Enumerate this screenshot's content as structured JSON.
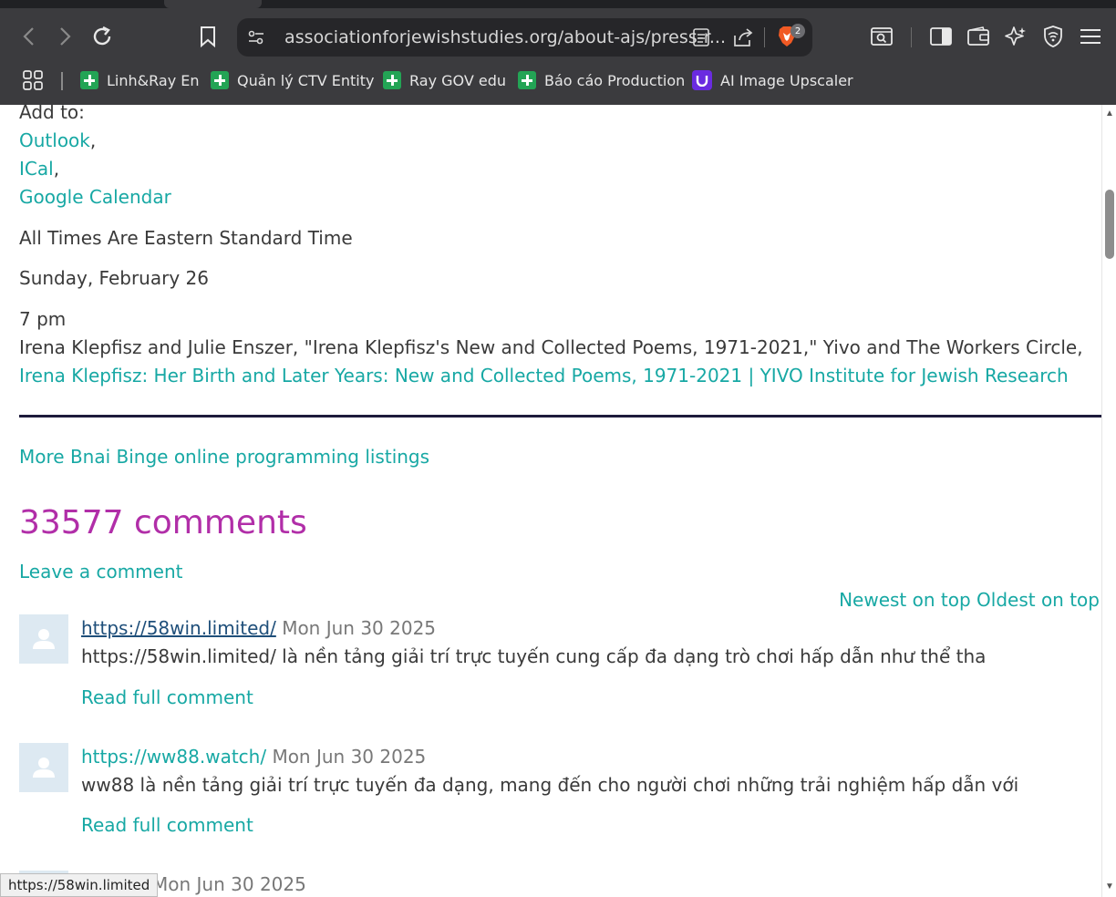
{
  "browser": {
    "url": "associationforjewishstudies.org/about-ajs/press-r...",
    "shields_count": "2",
    "bookmarks": [
      {
        "label": "Linh&Ray En",
        "icon": "sheets-icon"
      },
      {
        "label": "Quản lý CTV Entity",
        "icon": "sheets-icon"
      },
      {
        "label": "Ray GOV edu",
        "icon": "sheets-icon"
      },
      {
        "label": "Báo cáo Production",
        "icon": "sheets-icon"
      },
      {
        "label": "AI Image Upscaler",
        "icon": "upscaler-icon"
      }
    ],
    "status_url": "https://58win.limited"
  },
  "calendar": {
    "add_to_label": "Add to:",
    "outlook": "Outlook",
    "ical": "ICal",
    "google": "Google Calendar",
    "comma": ","
  },
  "event": {
    "timezone_note": "All Times Are Eastern Standard Time",
    "date": "Sunday, February 26",
    "time": "7 pm",
    "description": "Irena Klepfisz and Julie Enszer, \"Irena Klepfisz's New and Collected Poems, 1971-2021,\" Yivo and The Workers Circle,",
    "link": "Irena Klepfisz: Her Birth and Later Years: New and Collected Poems, 1971-2021 | YIVO Institute for Jewish Research"
  },
  "more_link": "More Bnai Binge online programming listings",
  "comments": {
    "title": "33577 comments",
    "leave_label": "Leave a comment",
    "sort_newest": "Newest on top",
    "sort_oldest": "Oldest on top",
    "items": [
      {
        "author": "https://58win.limited/",
        "date": "Mon Jun 30 2025",
        "excerpt": "https://58win.limited/ là nền tảng giải trí trực tuyến cung cấp đa dạng trò chơi hấp dẫn như thể tha",
        "read_more": "Read full comment"
      },
      {
        "author": "https://ww88.watch/",
        "date": "Mon Jun 30 2025",
        "excerpt": "ww88 là nền tảng giải trí trực tuyến đa dạng, mang đến cho người chơi những trải nghiệm hấp dẫn với",
        "read_more": "Read full comment"
      },
      {
        "date": "Mon Jun 30 2025"
      }
    ]
  },
  "colors": {
    "link_teal": "#17a8a4",
    "title_magenta": "#b12ea8",
    "rule_navy": "#1e1b3b",
    "chrome_bg": "#3b3b3e"
  }
}
